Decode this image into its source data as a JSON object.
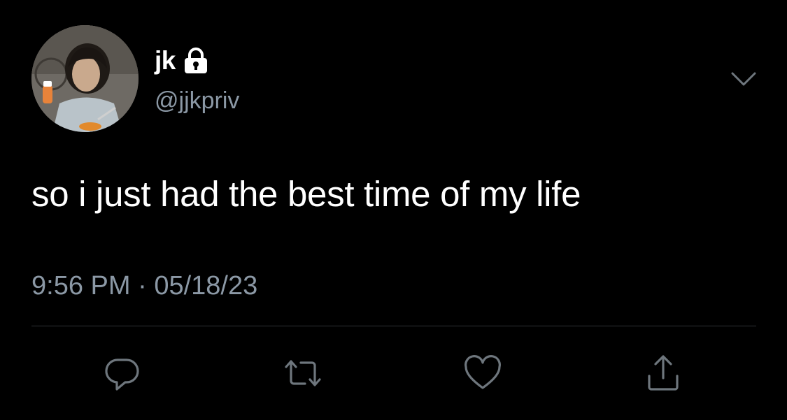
{
  "tweet": {
    "display_name": "jk",
    "handle": "@jjkpriv",
    "protected": true,
    "text": "so i just had the best time of my life",
    "time": "9:56 PM",
    "separator": "·",
    "date": "05/18/23"
  },
  "icons": {
    "lock": "lock-icon",
    "more_menu": "chevron-down-icon",
    "reply": "reply-icon",
    "retweet": "retweet-icon",
    "like": "heart-icon",
    "share": "share-icon"
  },
  "colors": {
    "background": "#000000",
    "text_primary": "#ffffff",
    "text_secondary": "#8b98a5",
    "divider": "#2f3336"
  }
}
